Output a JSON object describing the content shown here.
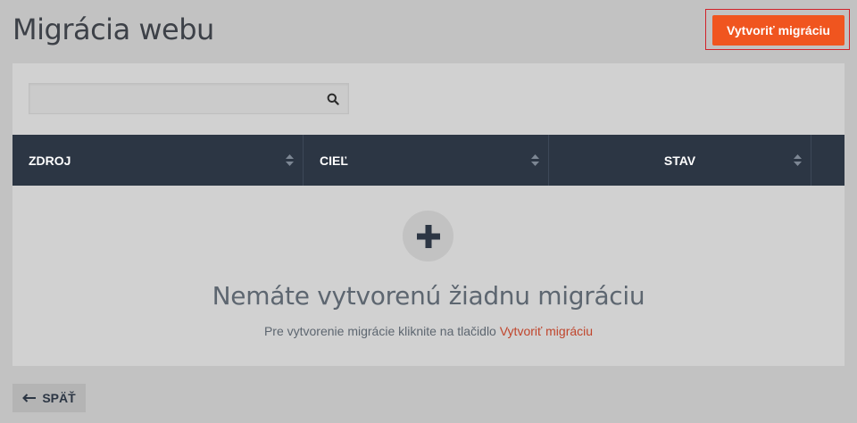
{
  "header": {
    "title": "Migrácia webu",
    "create_button_label": "Vytvoriť migráciu"
  },
  "search": {
    "value": "",
    "placeholder": "",
    "icon": "search-icon"
  },
  "table": {
    "columns": [
      "ZDROJ",
      "CIEĽ",
      "STAV"
    ],
    "rows": []
  },
  "empty_state": {
    "icon": "plus-icon",
    "title": "Nemáte vytvorenú žiadnu migráciu",
    "subtitle_prefix": "Pre vytvorenie migrácie kliknite na tlačidlo",
    "subtitle_link": "Vytvoriť migráciu"
  },
  "footer": {
    "back_label": "SPÄŤ",
    "back_icon": "arrow-left-icon"
  },
  "colors": {
    "accent": "#f0551f",
    "table_header": "#2c3644",
    "link": "#c0452c",
    "highlight_outline": "#d1222a"
  }
}
